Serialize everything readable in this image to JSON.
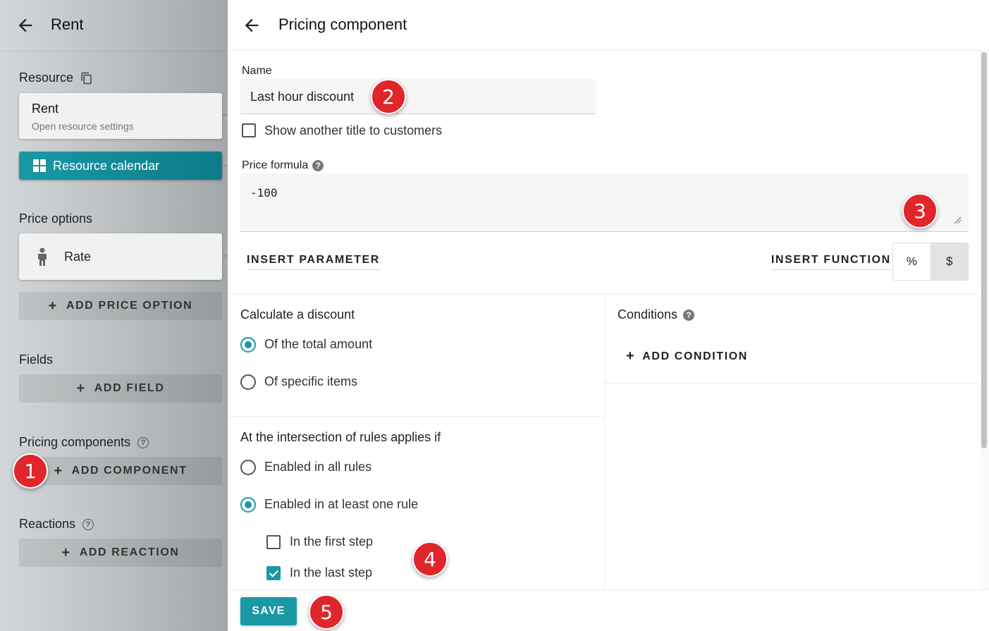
{
  "sidebar": {
    "title": "Rent",
    "resource_label": "Resource",
    "resource_card": {
      "title": "Rent",
      "subtitle": "Open resource settings"
    },
    "calendar_button": "Resource calendar",
    "price_options_label": "Price options",
    "rate_card": "Rate",
    "add_price_option": "ADD PRICE OPTION",
    "fields_label": "Fields",
    "add_field": "ADD FIELD",
    "pricing_components_label": "Pricing components",
    "add_component": "ADD COMPONENT",
    "reactions_label": "Reactions",
    "add_reaction": "ADD REACTION"
  },
  "main": {
    "title": "Pricing component",
    "name_label": "Name",
    "name_value": "Last hour discount",
    "show_title_label": "Show another title to customers",
    "show_title_checked": false,
    "formula_label": "Price formula",
    "formula_value": "-100",
    "insert_parameter": "INSERT PARAMETER",
    "insert_function": "INSERT FUNCTION",
    "unit_toggle": {
      "percent": "%",
      "dollar": "$",
      "selected": "$"
    },
    "discount": {
      "title": "Calculate a discount",
      "options": [
        "Of the total amount",
        "Of specific items"
      ],
      "selected": "Of the total amount"
    },
    "conditions": {
      "title": "Conditions",
      "add": "ADD CONDITION"
    },
    "intersection": {
      "title": "At the intersection of rules applies if",
      "options": [
        "Enabled in all rules",
        "Enabled in at least one rule"
      ],
      "selected": "Enabled in at least one rule",
      "steps": [
        {
          "label": "In the first step",
          "checked": false
        },
        {
          "label": "In the last step",
          "checked": true
        }
      ]
    },
    "save": "SAVE"
  },
  "badges": [
    "1",
    "2",
    "3",
    "4",
    "5"
  ],
  "colors": {
    "accent": "#1a98a6",
    "badge": "#e0262b"
  }
}
